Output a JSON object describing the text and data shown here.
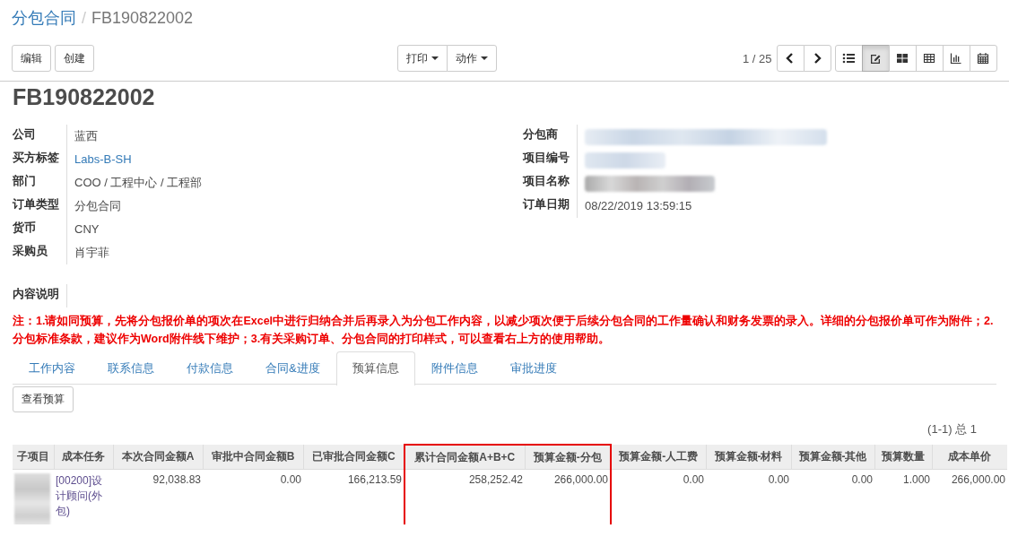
{
  "breadcrumb": {
    "parent": "分包合同",
    "separator": "/",
    "current": "FB190822002"
  },
  "buttons": [
    "编辑",
    "创建"
  ],
  "dropdowns": [
    "打印",
    "动作"
  ],
  "pager": "1 / 25",
  "views": [
    {
      "kind": "list",
      "selected": false
    },
    {
      "kind": "form",
      "selected": true
    },
    {
      "kind": "kanban",
      "selected": false
    },
    {
      "kind": "grid",
      "selected": false
    },
    {
      "kind": "graph",
      "selected": false
    },
    {
      "kind": "calendar",
      "selected": false
    }
  ],
  "title": "FB190822002",
  "fields_left": [
    {
      "label": "公司",
      "kind": "text",
      "value": "蓝西"
    },
    {
      "label": "买方标签",
      "kind": "link",
      "value": "Labs-B-SH"
    },
    {
      "label": "部门",
      "kind": "text",
      "value": "COO / 工程中心 / 工程部"
    },
    {
      "label": "订单类型",
      "kind": "text",
      "value": "分包合同"
    },
    {
      "label": "货币",
      "kind": "text",
      "value": "CNY"
    },
    {
      "label": "采购员",
      "kind": "text",
      "value": "肖宇菲"
    }
  ],
  "fields_right": [
    {
      "label": "分包商",
      "kind": "blurred"
    },
    {
      "label": "项目编号",
      "kind": "blurred"
    },
    {
      "label": "项目名称",
      "kind": "blurred"
    },
    {
      "label": "订单日期",
      "kind": "text",
      "value": "08/22/2019 13:59:15"
    }
  ],
  "description_label": "内容说明",
  "note": "注：1.请如同预算，先将分包报价单的项次在Excel中进行归纳合并后再录入为分包工作内容，以减少项次便于后续分包合同的工作量确认和财务发票的录入。详细的分包报价单可作为附件；2.分包标准条款，建议作为Word附件线下维护；3.有关采购订单、分包合同的打印样式，可以查看右上方的使用帮助。",
  "tabs": [
    {
      "label": "工作内容",
      "selected": false
    },
    {
      "label": "联系信息",
      "selected": false
    },
    {
      "label": "付款信息",
      "selected": false
    },
    {
      "label": "合同&进度",
      "selected": false
    },
    {
      "label": "预算信息",
      "selected": true
    },
    {
      "label": "附件信息",
      "selected": false
    },
    {
      "label": "审批进度",
      "selected": false
    }
  ],
  "budget_button": "查看预算",
  "record_count": "(1-1) 总 1",
  "table": {
    "columns": [
      {
        "label": "子项目",
        "highlighted": false
      },
      {
        "label": "成本任务",
        "highlighted": false
      },
      {
        "label": "本次合同金额A",
        "highlighted": false
      },
      {
        "label": "审批中合同金额B",
        "highlighted": false
      },
      {
        "label": "已审批合同金额C",
        "highlighted": false
      },
      {
        "label": "累计合同金额A+B+C",
        "highlighted": true
      },
      {
        "label": "预算金额-分包",
        "highlighted": true
      },
      {
        "label": "预算金额-人工费",
        "highlighted": false
      },
      {
        "label": "预算金额-材料",
        "highlighted": false
      },
      {
        "label": "预算金额-其他",
        "highlighted": false
      },
      {
        "label": "预算数量",
        "highlighted": false
      },
      {
        "label": "成本单价",
        "highlighted": false
      }
    ],
    "rows": [
      {
        "cells": [
          {
            "kind": "blurred"
          },
          {
            "kind": "link",
            "value": "[00200]设计顾问(外包)"
          },
          {
            "kind": "number",
            "value": "92,038.83"
          },
          {
            "kind": "number",
            "value": "0.00"
          },
          {
            "kind": "number",
            "value": "166,213.59"
          },
          {
            "kind": "number",
            "value": "258,252.42"
          },
          {
            "kind": "number",
            "value": "266,000.00"
          },
          {
            "kind": "number",
            "value": "0.00"
          },
          {
            "kind": "number",
            "value": "0.00"
          },
          {
            "kind": "number",
            "value": "0.00"
          },
          {
            "kind": "number",
            "value": "1.000"
          },
          {
            "kind": "number",
            "value": "266,000.00"
          }
        ]
      }
    ]
  }
}
